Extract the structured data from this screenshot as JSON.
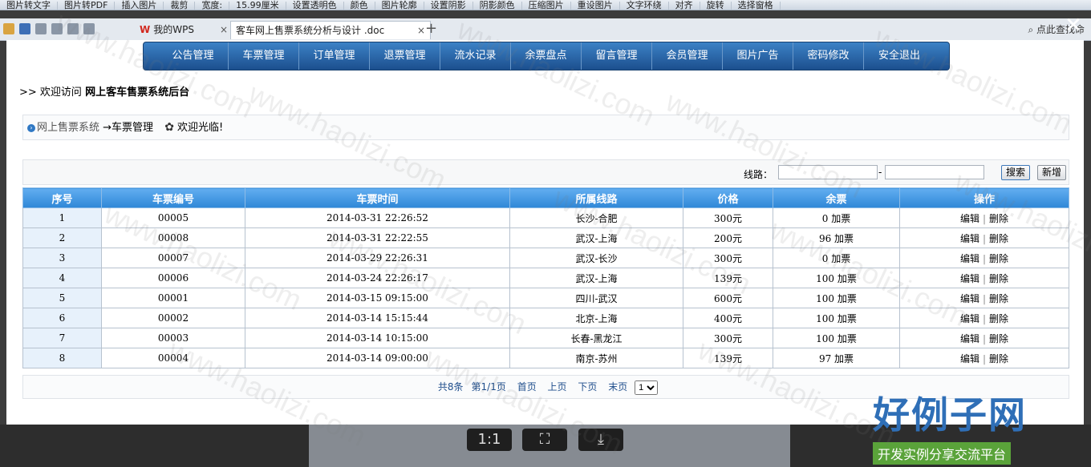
{
  "ribbon": {
    "items": [
      "图片转文字",
      "图片转PDF",
      "插入图片",
      "裁剪",
      "宽度:",
      "15.99厘米",
      "设置透明色",
      "颜色",
      "图片轮廓",
      "设置阴影",
      "阴影颜色",
      "压缩图片",
      "重设图片",
      "文字环绕",
      "对齐",
      "旋转",
      "选择窗格"
    ]
  },
  "tabs": {
    "wps_label": "我的WPS",
    "doc_label": "客车网上售票系统分析与设计 .doc",
    "close": "×",
    "add": "+",
    "search": "点此查找命"
  },
  "overlay": {
    "close": "✕"
  },
  "nav": {
    "items": [
      "公告管理",
      "车票管理",
      "订单管理",
      "退票管理",
      "流水记录",
      "余票盘点",
      "留言管理",
      "会员管理",
      "图片广告",
      "密码修改",
      "安全退出"
    ]
  },
  "welcome": {
    "prefix": ">> 欢迎访问",
    "title": "网上客车售票系统后台"
  },
  "breadcrumb": {
    "system": "网上售票系统",
    "current": "→车票管理",
    "greeting": "欢迎光临!"
  },
  "filter": {
    "label": "线路：",
    "dash": "-",
    "search_btn": "搜索",
    "add_btn": "新增",
    "from_value": "",
    "to_value": ""
  },
  "table": {
    "headers": [
      "序号",
      "车票编号",
      "车票时间",
      "所属线路",
      "价格",
      "余票",
      "操作"
    ],
    "rows": [
      {
        "no": "1",
        "code": "00005",
        "time": "2014-03-31 22:26:52",
        "route": "长沙-合肥",
        "price": "300元",
        "remain": "0 加票"
      },
      {
        "no": "2",
        "code": "00008",
        "time": "2014-03-31 22:22:55",
        "route": "武汉-上海",
        "price": "200元",
        "remain": "96 加票"
      },
      {
        "no": "3",
        "code": "00007",
        "time": "2014-03-29 22:26:31",
        "route": "武汉-长沙",
        "price": "300元",
        "remain": "0 加票"
      },
      {
        "no": "4",
        "code": "00006",
        "time": "2014-03-24 22:26:17",
        "route": "武汉-上海",
        "price": "139元",
        "remain": "100 加票"
      },
      {
        "no": "5",
        "code": "00001",
        "time": "2014-03-15 09:15:00",
        "route": "四川-武汉",
        "price": "600元",
        "remain": "100 加票"
      },
      {
        "no": "6",
        "code": "00002",
        "time": "2014-03-14 15:15:44",
        "route": "北京-上海",
        "price": "400元",
        "remain": "100 加票"
      },
      {
        "no": "7",
        "code": "00003",
        "time": "2014-03-14 10:15:00",
        "route": "长春-黑龙江",
        "price": "300元",
        "remain": "100 加票"
      },
      {
        "no": "8",
        "code": "00004",
        "time": "2014-03-14 09:00:00",
        "route": "南京-苏州",
        "price": "139元",
        "remain": "97 加票"
      }
    ],
    "edit": "编辑",
    "delete": "删除",
    "sep": "|"
  },
  "pager": {
    "total": "共8条",
    "page": "第1/1页",
    "first": "首页",
    "prev": "上页",
    "next": "下页",
    "last": "末页",
    "select_value": "1"
  },
  "viewer": {
    "actual": "1:1",
    "fit": "⛶",
    "save": "⤓"
  },
  "brand": {
    "title": "好例子网",
    "subtitle": "开发实例分享交流平台"
  },
  "watermark": "www.haolizi.com"
}
